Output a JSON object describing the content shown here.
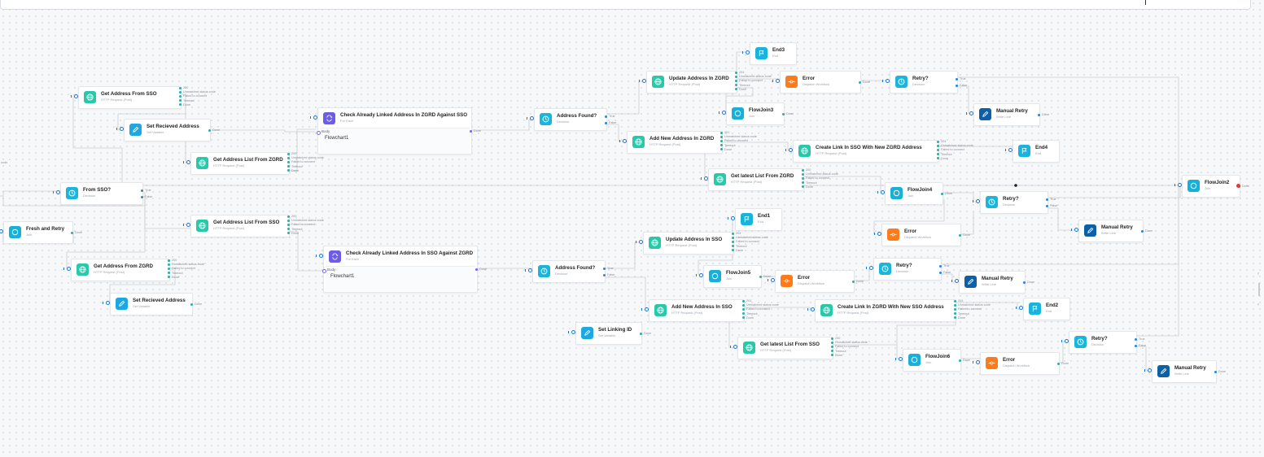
{
  "colors": {
    "http": "#27c9a8",
    "var": "#1ea7e1",
    "decision": "#19b6dc",
    "join": "#16b0d8",
    "end": "#17b5dd",
    "error": "#ff7a1a",
    "manual": "#0d5fa6",
    "foreach": "#6e5ce6",
    "wire": "#c9cdd3",
    "error_dot": "#e53935"
  },
  "nodes": {
    "get_addr_sso": {
      "title": "Get Address From SSO",
      "sub": "HTTP Request (Post)",
      "outs": [
        "200",
        "Unmatched status code",
        "Failed to connect",
        "Timeout",
        "Done"
      ]
    },
    "set_recv_1": {
      "title": "Set Recieved Address",
      "sub": "Set Variable",
      "outs": [
        "Done"
      ]
    },
    "check_zgrd": {
      "title": "Check Already Linked Address In ZGRD Against SSO",
      "sub": "For Each",
      "body": "Body",
      "flow": "Flowchart1",
      "outs": [
        "Done"
      ]
    },
    "get_list_zgrd": {
      "title": "Get Address List From ZGRD",
      "sub": "HTTP Request (Post)",
      "outs": [
        "200",
        "Unmatched status code",
        "Failed to connect",
        "Timeout",
        "Done"
      ]
    },
    "from_sso": {
      "title": "From SSO?",
      "sub": "Decision",
      "outs": [
        "True",
        "False"
      ]
    },
    "fresh_retry": {
      "title": "Fresh and Retry",
      "sub": "Join",
      "outs": [
        "Done"
      ]
    },
    "left_frag": {
      "outs": [
        "s code",
        "t"
      ]
    },
    "get_list_sso": {
      "title": "Get Address List From SSO",
      "sub": "HTTP Request (Post)",
      "outs": [
        "200",
        "Unmatched status code",
        "Failed to connect",
        "Timeout",
        "Done"
      ]
    },
    "get_addr_zgrd": {
      "title": "Get Address From ZGRD",
      "sub": "HTTP Request (Post)",
      "outs": [
        "200",
        "Unmatched status code",
        "Failed to connect",
        "Timeout",
        "Done"
      ]
    },
    "set_recv_2": {
      "title": "Set Recieved Address",
      "sub": "Set Variable",
      "outs": [
        "Done"
      ]
    },
    "check_sso": {
      "title": "Check Already Linked Address In SSO Against ZGRD",
      "sub": "For Each",
      "body": "Body",
      "flow": "Flowchart1",
      "outs": [
        "Done"
      ]
    },
    "found_1": {
      "title": "Address Found?",
      "sub": "Decision",
      "outs": [
        "True",
        "False"
      ]
    },
    "found_2": {
      "title": "Address Found?",
      "sub": "Decision",
      "outs": [
        "True",
        "False"
      ]
    },
    "set_linking": {
      "title": "Set Linking ID",
      "sub": "Set Variable",
      "outs": [
        "Done"
      ]
    },
    "upd_zgrd": {
      "title": "Update Address In ZGRD",
      "sub": "HTTP Request (Post)",
      "outs": [
        "204",
        "Unmatched status code",
        "Failed to connect",
        "Timeout",
        "Done"
      ]
    },
    "add_zgrd": {
      "title": "Add New Address In ZGRD",
      "sub": "HTTP Request (Post)",
      "outs": [
        "201",
        "Unmatched status code",
        "Failed to connect",
        "Timeout",
        "Done"
      ]
    },
    "end3": {
      "title": "End3",
      "sub": "End"
    },
    "flowjoin3": {
      "title": "FlowJoin3",
      "sub": "Join",
      "outs": [
        "Done"
      ]
    },
    "error_1": {
      "title": "Error",
      "sub": "Dispatch Workflow",
      "outs": [
        "Done"
      ]
    },
    "retry_1": {
      "title": "Retry?",
      "sub": "Decision",
      "outs": [
        "True",
        "False"
      ]
    },
    "manual_1": {
      "title": "Manual Retry",
      "sub": "Write Line",
      "outs": [
        "Done"
      ]
    },
    "create_sso": {
      "title": "Create Link In SSO With New ZGRD Address",
      "sub": "HTTP Request (Post)",
      "outs": [
        "204",
        "Unmatched status code",
        "Failed to connect",
        "Timeout",
        "Done"
      ]
    },
    "end4": {
      "title": "End4",
      "sub": "End"
    },
    "latest_zgrd": {
      "title": "Get latest List From ZGRD",
      "sub": "HTTP Request (Post)",
      "outs": [
        "200",
        "Unmatched status code",
        "Failed to connect",
        "Timeout",
        "Done"
      ]
    },
    "flowjoin4": {
      "title": "FlowJoin4",
      "sub": "Join",
      "outs": [
        "Done"
      ]
    },
    "retry_2": {
      "title": "Retry?",
      "sub": "Decision",
      "outs": [
        "True",
        "False"
      ]
    },
    "error_2": {
      "title": "Error",
      "sub": "Dispatch Workflow",
      "outs": [
        "Done"
      ]
    },
    "manual_2": {
      "title": "Manual Retry",
      "sub": "Write Line",
      "outs": [
        "Done"
      ]
    },
    "flowjoin2": {
      "title": "FlowJoin2",
      "sub": "Join",
      "outs": [
        "Done"
      ]
    },
    "upd_sso": {
      "title": "Update Address In SSO",
      "sub": "HTTP Request (Post)",
      "outs": [
        "204",
        "Unmatched status code",
        "Failed to connect",
        "Timeout",
        "Done"
      ]
    },
    "end1": {
      "title": "End1",
      "sub": "End"
    },
    "flowjoin5": {
      "title": "FlowJoin5",
      "sub": "Join",
      "outs": [
        "Done"
      ]
    },
    "error_3": {
      "title": "Error",
      "sub": "Dispatch Workflow",
      "outs": [
        "Done"
      ]
    },
    "retry_3": {
      "title": "Retry?",
      "sub": "Decision",
      "outs": [
        "True",
        "False"
      ]
    },
    "manual_3": {
      "title": "Manual Retry",
      "sub": "Write Line",
      "outs": [
        "Done"
      ]
    },
    "add_sso": {
      "title": "Add New Address In SSO",
      "sub": "HTTP Request (Post)",
      "outs": [
        "201",
        "Unmatched status code",
        "Failed to connect",
        "Timeout",
        "Done"
      ]
    },
    "create_zgrd": {
      "title": "Create Link In ZGRD With New SSO Address",
      "sub": "HTTP Request (Post)",
      "outs": [
        "204",
        "Unmatched status code",
        "Failed to connect",
        "Timeout",
        "Done"
      ]
    },
    "end2": {
      "title": "End2",
      "sub": "End"
    },
    "latest_sso": {
      "title": "Get latest List From SSO",
      "sub": "HTTP Request (Post)",
      "outs": [
        "200",
        "Unmatched status code",
        "Failed to connect",
        "Timeout",
        "Done"
      ]
    },
    "flowjoin6": {
      "title": "FlowJoin6",
      "sub": "Join",
      "outs": [
        "Done"
      ]
    },
    "error_4": {
      "title": "Error",
      "sub": "Dispatch Workflow",
      "outs": [
        "Done"
      ]
    },
    "retry_4": {
      "title": "Retry?",
      "sub": "Decision",
      "outs": [
        "True",
        "False"
      ]
    },
    "manual_4": {
      "title": "Manual Retry",
      "sub": "Write Line",
      "outs": [
        "Done"
      ]
    }
  }
}
